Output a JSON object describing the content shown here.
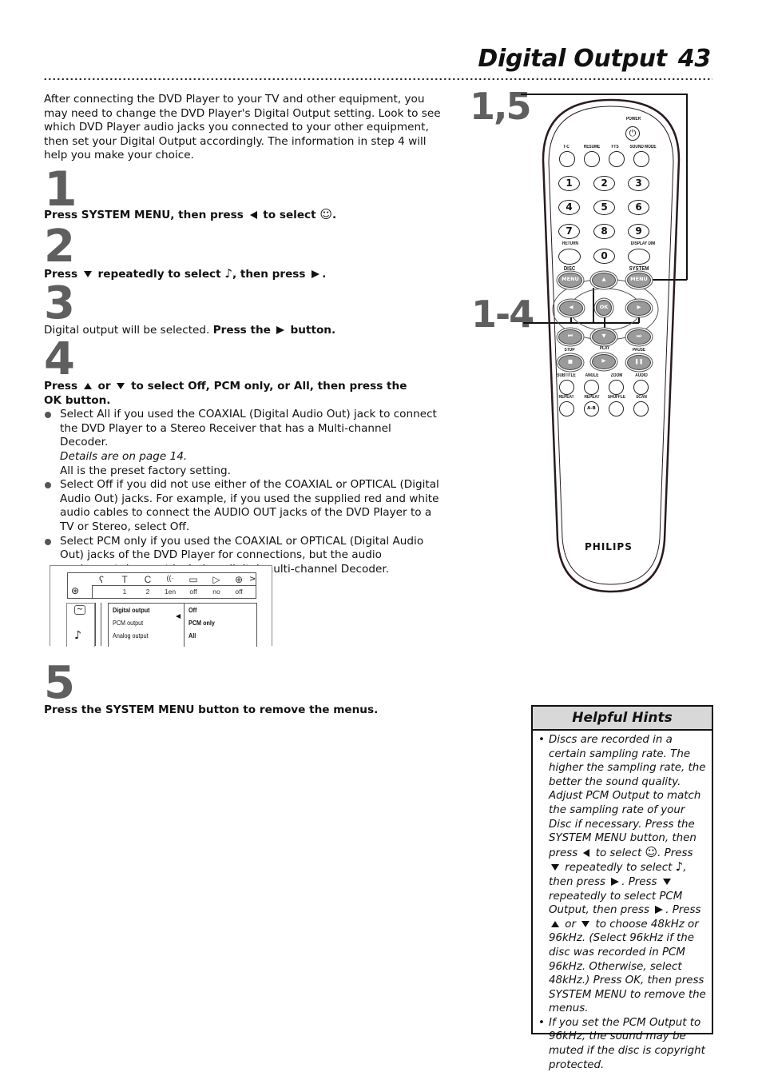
{
  "header": {
    "title": "Digital Output",
    "page_number": "43"
  },
  "intro": "After connecting the DVD Player to your TV and other equipment, you may need to change the DVD Player's Digital Output setting. Look to see which DVD Player audio jacks you connected to your other equipment, then set your Digital Output accordingly. The information in step 4 will help you make your choice.",
  "steps": [
    {
      "number": "1",
      "parts": {
        "a": "Press SYSTEM MENU, then press",
        "b": "to select",
        "c": "."
      }
    },
    {
      "number": "2",
      "parts": {
        "a": "Press",
        "b": "repeatedly to select",
        "c": ", then press",
        "d": "."
      }
    },
    {
      "number": "3",
      "parts": {
        "a": "Digital output will be selected.",
        "b": "Press the",
        "c": "button."
      }
    },
    {
      "number": "4",
      "parts": {
        "a": "Press",
        "b": "or",
        "c": "to select Off, PCM only, or All, then press the OK button."
      },
      "bullets": [
        {
          "text": "Select All if you used the COAXIAL (Digital Audio Out) jack to connect the DVD Player to a Stereo Receiver that has a Multi-channel Decoder.",
          "note_italic": "Details are on page 14.",
          "note": "All is the preset factory setting."
        },
        {
          "text": "Select Off if you did not use either of the COAXIAL or OPTICAL (Digital Audio Out) jacks. For example, if you used the supplied red and white audio cables to connect the AUDIO OUT jacks of the DVD Player to a TV or Stereo, select Off."
        },
        {
          "text": "Select PCM only if you used the COAXIAL or OPTICAL (Digital Audio Out) jacks of the DVD Player for connections, but the audio equipment does not include a digital multi-channel Decoder."
        }
      ]
    },
    {
      "number": "5",
      "parts": {
        "a": "Press the",
        "b": "SYSTEM MENU",
        "c": "button to remove the menus."
      }
    }
  ],
  "osd": {
    "top_icons": [
      "ʕ",
      "T",
      "C",
      "((·",
      "▭",
      "▷",
      "⊕"
    ],
    "top_values": [
      "1",
      "2",
      "1en",
      "off",
      "no",
      "off"
    ],
    "menu_items": [
      "Digital output",
      "PCM output",
      "Analog output"
    ],
    "options": [
      "Off",
      "PCM only",
      "All"
    ],
    "more_arrow": ">"
  },
  "remote": {
    "callout_top": "1,5",
    "callout_mid": "1-4",
    "labels": {
      "power": "POWER",
      "row1": [
        "T-C",
        "RESUME",
        "FTS",
        "SOUND MODE"
      ],
      "numbers": [
        "1",
        "2",
        "3",
        "4",
        "5",
        "6",
        "7",
        "8",
        "9",
        "0"
      ],
      "return": "RETURN",
      "display_dim": "DISPLAY DIM",
      "disc": "DISC",
      "system": "SYSTEM",
      "menu": "MENU",
      "ok": "OK",
      "transport": [
        "STOP",
        "PLAY",
        "PAUSE"
      ],
      "row_a": [
        "SUBTITLE",
        "ANGLE",
        "ZOOM",
        "AUDIO"
      ],
      "row_b": [
        "REPEAT",
        "REPEAT",
        "SHUFFLE",
        "SCAN"
      ],
      "ab": "A-B",
      "brand": "PHILIPS"
    }
  },
  "hints": {
    "title": "Helpful Hints",
    "item1": {
      "a": "Discs are recorded in a certain sampling rate. The higher the sampling rate, the better the sound quality. Adjust PCM Output to match the sampling rate of your Disc if necessary. Press the SYSTEM MENU button, then press",
      "b": "to select",
      "c": ". Press",
      "d": "repeatedly to select",
      "e": ", then press",
      "f": ". Press",
      "g": "repeatedly to select PCM Output, then press",
      "h": ". Press",
      "i": "or",
      "j": "to choose 48kHz or 96kHz. (Select 96kHz if the disc was recorded in PCM 96kHz. Otherwise, select 48kHz.) Press OK, then press SYSTEM MENU to remove the menus."
    },
    "item2": "If you set the PCM Output to 96kHz, the sound may be muted if the disc is copyright protected."
  }
}
